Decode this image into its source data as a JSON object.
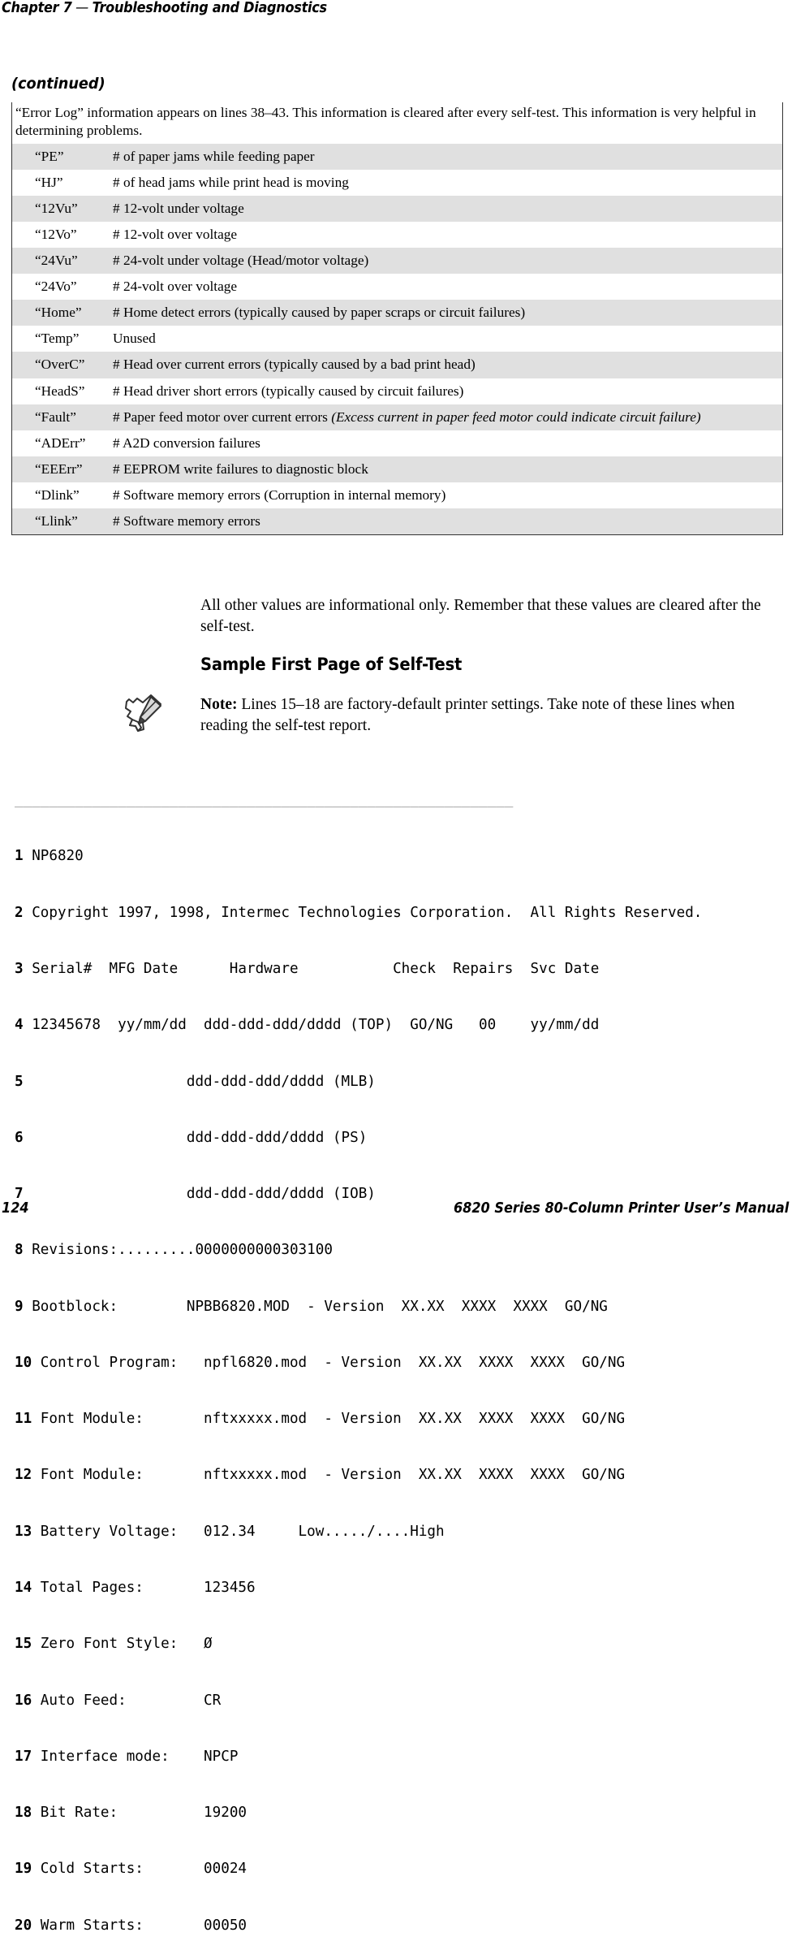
{
  "header": {
    "chapter_label": "Chapter 7",
    "dash": "—",
    "chapter_title": "Troubleshooting and Diagnostics"
  },
  "continued_label": "(continued)",
  "intro_paragraph": "“Error Log” information appears on lines 38–43. This information is cleared after every self-test. This information is very helpful in determining problems.",
  "error_table": {
    "rows": [
      {
        "code": "“PE”",
        "desc": "# of paper jams while feeding paper"
      },
      {
        "code": "“HJ”",
        "desc": "# of head jams while print head is moving"
      },
      {
        "code": "“12Vu”",
        "desc": "# 12-volt under voltage"
      },
      {
        "code": "“12Vo”",
        "desc": "# 12-volt over voltage"
      },
      {
        "code": "“24Vu”",
        "desc": "# 24-volt under voltage (Head/motor voltage)"
      },
      {
        "code": "“24Vo”",
        "desc": "# 24-volt over voltage"
      },
      {
        "code": "“Home”",
        "desc": "# Home detect errors (typically caused by paper scraps or circuit failures)"
      },
      {
        "code": "“Temp”",
        "desc": "Unused"
      },
      {
        "code": "“OverC”",
        "desc": "# Head over current errors (typically caused by a bad print head)"
      },
      {
        "code": "“HeadS”",
        "desc": "# Head driver short errors (typically caused by circuit failures)"
      },
      {
        "code": "“Fault”",
        "desc": "# Paper feed motor over current errors ",
        "desc_italic": "(Excess current in paper feed motor could indicate circuit failure)"
      },
      {
        "code": "“ADErr”",
        "desc": "# A2D conversion failures"
      },
      {
        "code": "“EEErr”",
        "desc": "# EEPROM write failures to diagnostic block"
      },
      {
        "code": "“Dlink”",
        "desc": "# Software memory errors (Corruption in internal memory)"
      },
      {
        "code": "“Llink”",
        "desc": "# Software memory errors"
      }
    ]
  },
  "body_paragraph": "All other values are informational only. Remember that these values are cleared after the self-test.",
  "section_heading": "Sample First Page of Self-Test",
  "note": {
    "label": "Note:",
    "text": " Lines 15–18 are factory-default printer settings. Take note of these lines when reading the self-test report."
  },
  "listing": {
    "rule": "__________________________________________________________",
    "lines": [
      {
        "num": "1",
        "text": "NP6820"
      },
      {
        "num": "2",
        "text": "Copyright 1997, 1998, Intermec Technologies Corporation.  All Rights Reserved."
      },
      {
        "num": "3",
        "text": "Serial#  MFG Date      Hardware           Check  Repairs  Svc Date"
      },
      {
        "num": "4",
        "text": "12345678  yy/mm/dd  ddd-ddd-ddd/dddd (TOP)  GO/NG   00    yy/mm/dd"
      },
      {
        "num": "5",
        "text": "                  ddd-ddd-ddd/dddd (MLB)"
      },
      {
        "num": "6",
        "text": "                  ddd-ddd-ddd/dddd (PS)"
      },
      {
        "num": "7",
        "text": "                  ddd-ddd-ddd/dddd (IOB)"
      },
      {
        "num": "8",
        "text": "Revisions:.........0000000000303100"
      },
      {
        "num": "9",
        "text": "Bootblock:        NPBB6820.MOD  - Version  XX.XX  XXXX  XXXX  GO/NG"
      },
      {
        "num": "10",
        "text": "Control Program:   npfl6820.mod  - Version  XX.XX  XXXX  XXXX  GO/NG"
      },
      {
        "num": "11",
        "text": "Font Module:       nftxxxxx.mod  - Version  XX.XX  XXXX  XXXX  GO/NG"
      },
      {
        "num": "12",
        "text": "Font Module:       nftxxxxx.mod  - Version  XX.XX  XXXX  XXXX  GO/NG"
      },
      {
        "num": "13",
        "text": "Battery Voltage:   012.34     Low...../....High"
      },
      {
        "num": "14",
        "text": "Total Pages:       123456"
      },
      {
        "num": "15",
        "text": "Zero Font Style:   Ø"
      },
      {
        "num": "16",
        "text": "Auto Feed:         CR"
      },
      {
        "num": "17",
        "text": "Interface mode:    NPCP"
      },
      {
        "num": "18",
        "text": "Bit Rate:          19200"
      },
      {
        "num": "19",
        "text": "Cold Starts:       00024"
      },
      {
        "num": "20",
        "text": "Warm Starts:       00050"
      }
    ]
  },
  "footer": {
    "page_number": "124",
    "manual_title": "6820 Series 80-Column Printer User’s Manual"
  },
  "colors": {
    "shade_row": "#e0e0e0",
    "rule": "#808080",
    "border": "#333333",
    "text": "#000000"
  }
}
